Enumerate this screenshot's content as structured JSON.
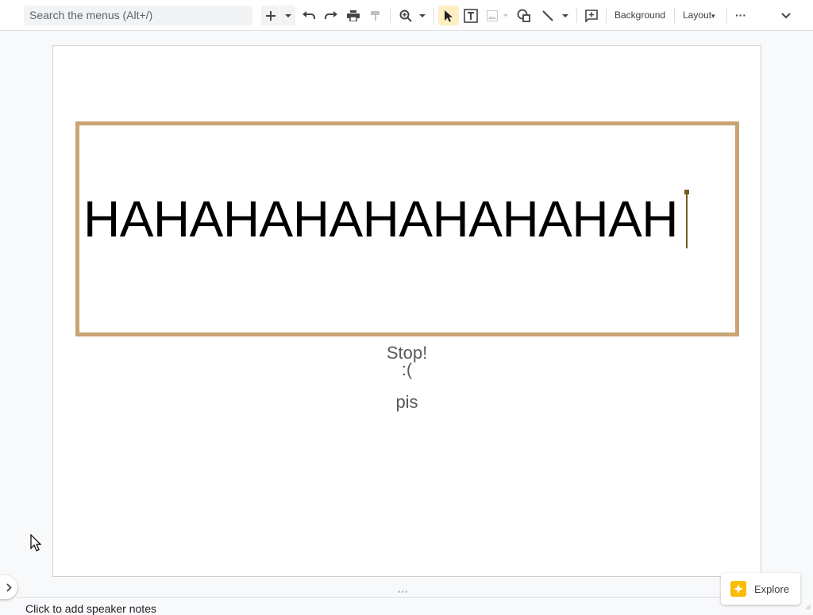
{
  "toolbar": {
    "search_placeholder": "Search the menus (Alt+/)",
    "background_label": "Background",
    "layout_label": "Layout",
    "layout_caret": "▾",
    "more_label": "···"
  },
  "slide": {
    "main_text": "HAHAHAHAHAHAHAHAH",
    "line1": "Stop!",
    "line2": ":(",
    "line3": "pis"
  },
  "notes": {
    "placeholder": "Click to add speaker notes"
  },
  "explore": {
    "label": "Explore"
  },
  "colors": {
    "textbox_border": "#c9a472",
    "active_tool_bg": "#feefc3",
    "explore_icon": "#fbbc04"
  },
  "icons": [
    "plus-icon",
    "chevron-down-icon",
    "undo-icon",
    "redo-icon",
    "print-icon",
    "paint-format-icon",
    "zoom-icon",
    "select-arrow-icon",
    "text-box-icon",
    "image-icon",
    "shape-icon",
    "line-icon",
    "comment-add-icon",
    "more-icon",
    "collapse-icon",
    "explore-icon"
  ]
}
